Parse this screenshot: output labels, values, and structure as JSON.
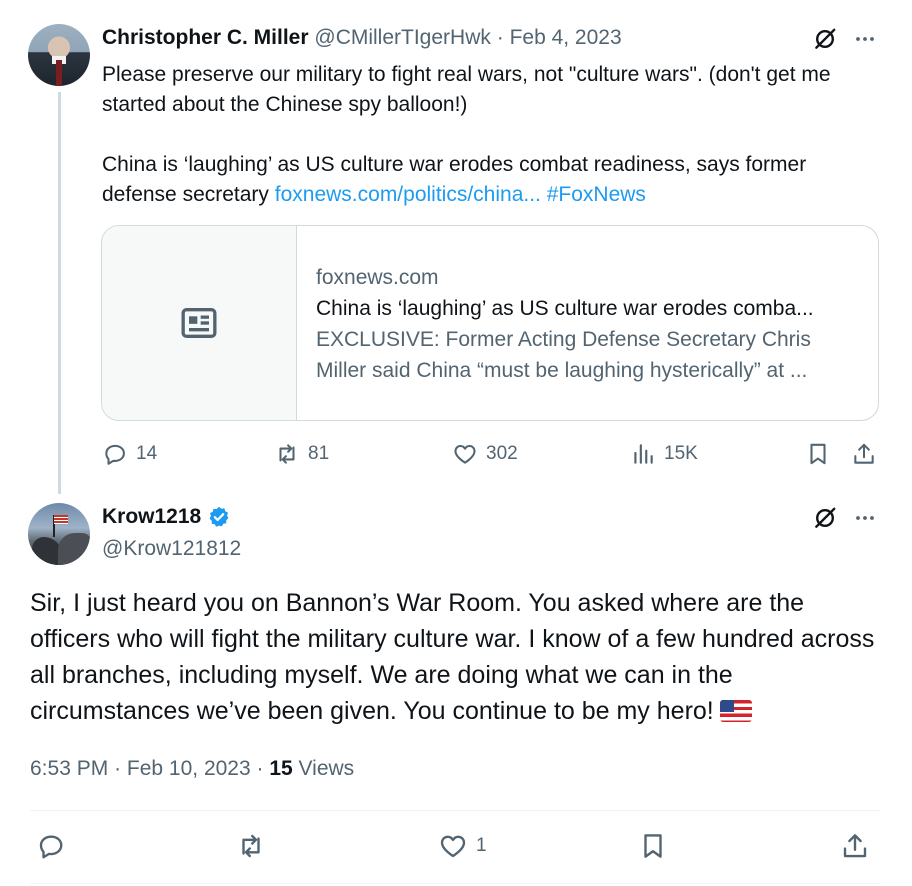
{
  "parent": {
    "author_name": "Christopher C. Miller",
    "author_handle": "@CMillerTIgerHwk",
    "separator": "·",
    "date": "Feb 4, 2023",
    "text_line1": "Please preserve our military to fight real wars, not \"culture wars\". (don't get me started about the Chinese spy balloon!)",
    "text_line2": "China is ‘laughing’ as US culture war erodes combat readiness, says former defense secretary ",
    "link_text": "foxnews.com/politics/china...",
    "hashtag": "#FoxNews",
    "card": {
      "domain": "foxnews.com",
      "title": "China is ‘laughing’ as US culture war erodes comba...",
      "desc_line1": "EXCLUSIVE: Former Acting Defense Secretary Chris",
      "desc_line2": "Miller said China “must be laughing hysterically” at ...",
      "thumb_icon": "article-icon"
    },
    "stats": {
      "replies": "14",
      "reposts": "81",
      "likes": "302",
      "views": "15K"
    }
  },
  "reply": {
    "author_name": "Krow1218",
    "verified": true,
    "author_handle": "@Krow121812",
    "text": "Sir, I just heard you on Bannon’s War Room. You asked where are the officers who will fight the military culture war. I know of a few hundred across all branches, including myself. We are doing what we can in the circumstances we’ve been given. You continue to be my hero!",
    "emoji": "us-flag-emoji",
    "time": "6:53 PM",
    "date": "Feb 10, 2023",
    "views_count": "15",
    "views_label": "Views",
    "stats": {
      "likes": "1"
    }
  },
  "colors": {
    "text": "#0f1419",
    "muted": "#536471",
    "link": "#1d9bf0",
    "verified": "#1d9bf0",
    "border": "#cfd9de"
  }
}
